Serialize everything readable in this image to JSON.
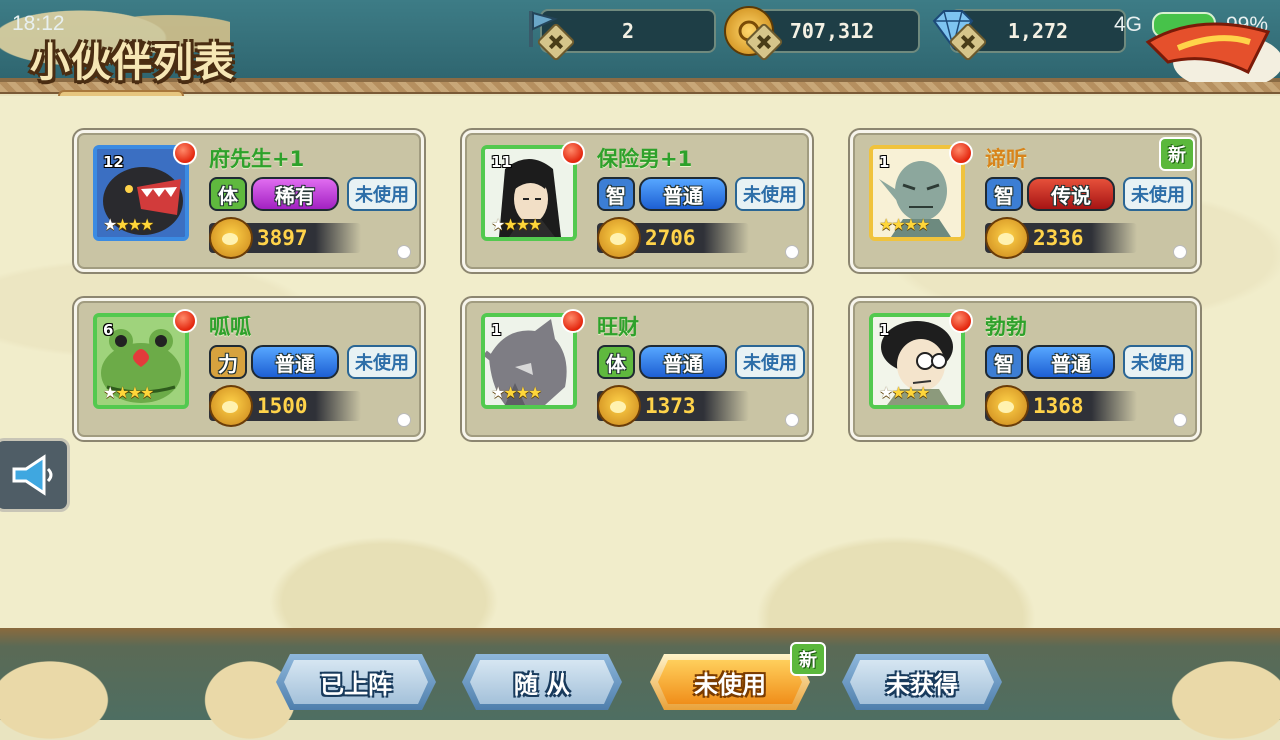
{
  "status_bar": {
    "time": "18:12",
    "network": "4G",
    "battery": "99%"
  },
  "header": {
    "title": "小伙伴列表",
    "resources": [
      {
        "name": "stamina",
        "icon": "flag-icon",
        "value": "2"
      },
      {
        "name": "coins",
        "icon": "coin-icon",
        "value": "707,312"
      },
      {
        "name": "gems",
        "icon": "diamond-icon",
        "value": "1,272"
      }
    ]
  },
  "cards": [
    {
      "name": "府先生+1",
      "level": "12",
      "attribute": "体",
      "rarity": "稀有",
      "status": "未使用",
      "power": "3897",
      "stars": 4,
      "filled_stars": 3,
      "is_new": false,
      "frame": "blue",
      "name_color": "green",
      "portrait": "panther"
    },
    {
      "name": "保险男+1",
      "level": "11",
      "attribute": "智",
      "rarity": "普通",
      "status": "未使用",
      "power": "2706",
      "stars": 4,
      "filled_stars": 3,
      "is_new": false,
      "frame": "green",
      "name_color": "green",
      "portrait": "man-longhair"
    },
    {
      "name": "谛听",
      "level": "1",
      "attribute": "智",
      "rarity": "传说",
      "status": "未使用",
      "power": "2336",
      "stars": 4,
      "filled_stars": 4,
      "is_new": true,
      "new_label": "新",
      "frame": "gold",
      "name_color": "gold",
      "portrait": "elf-creature"
    },
    {
      "name": "呱呱",
      "level": "6",
      "attribute": "力",
      "rarity": "普通",
      "status": "未使用",
      "power": "1500",
      "stars": 4,
      "filled_stars": 3,
      "is_new": false,
      "frame": "green",
      "name_color": "green",
      "portrait": "frog"
    },
    {
      "name": "旺财",
      "level": "1",
      "attribute": "体",
      "rarity": "普通",
      "status": "未使用",
      "power": "1373",
      "stars": 4,
      "filled_stars": 3,
      "is_new": false,
      "frame": "green",
      "name_color": "green",
      "portrait": "wolf"
    },
    {
      "name": "勃勃",
      "level": "1",
      "attribute": "智",
      "rarity": "普通",
      "status": "未使用",
      "power": "1368",
      "stars": 4,
      "filled_stars": 3,
      "is_new": false,
      "frame": "green",
      "name_color": "green",
      "portrait": "boy-glasses"
    }
  ],
  "tabs": [
    {
      "label": "已上阵",
      "active": false
    },
    {
      "label": "随 从",
      "active": false
    },
    {
      "label": "未使用",
      "active": true,
      "badge": "新"
    },
    {
      "label": "未获得",
      "active": false
    }
  ],
  "colors": {
    "header_bg": "#3d7c86",
    "panel_bg": "#f1edcb",
    "card_bg": "#c9c4a4",
    "name_green": "#2ea12b",
    "name_gold": "#d8841b",
    "power_gold": "#ffd34a"
  }
}
